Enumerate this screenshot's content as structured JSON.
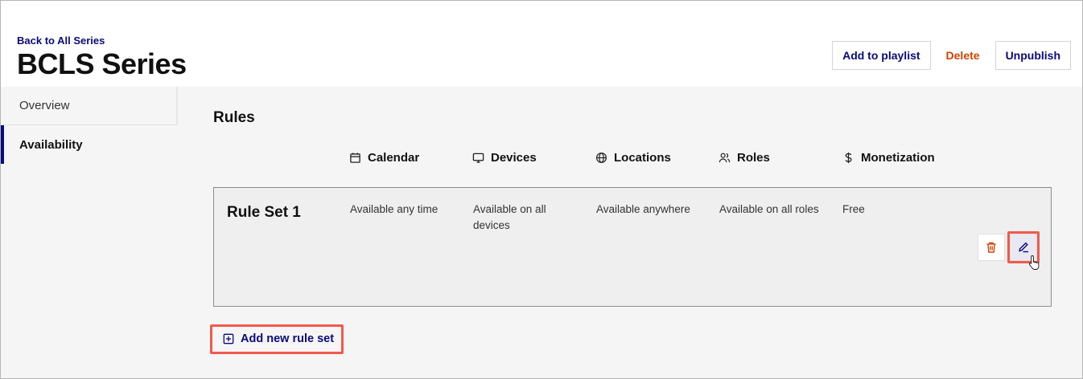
{
  "header": {
    "back_link": "Back to All Series",
    "title": "BCLS Series",
    "actions": {
      "add_to_playlist": "Add to playlist",
      "delete": "Delete",
      "unpublish": "Unpublish"
    }
  },
  "sidebar": {
    "items": [
      {
        "label": "Overview",
        "active": false
      },
      {
        "label": "Availability",
        "active": true
      }
    ]
  },
  "rules": {
    "title": "Rules",
    "columns": [
      {
        "label": "Calendar",
        "icon": "calendar-icon"
      },
      {
        "label": "Devices",
        "icon": "monitor-icon"
      },
      {
        "label": "Locations",
        "icon": "globe-icon"
      },
      {
        "label": "Roles",
        "icon": "users-icon"
      },
      {
        "label": "Monetization",
        "icon": "dollar-icon"
      }
    ],
    "rule_sets": [
      {
        "name": "Rule Set 1",
        "calendar": "Available any time",
        "devices": "Available on all devices",
        "locations": "Available anywhere",
        "roles": "Available on all roles",
        "monetization": "Free"
      }
    ],
    "add_rule_set": "Add new rule set"
  },
  "colors": {
    "accent": "#0a0a7a",
    "danger": "#d14300",
    "highlight": "#f05a4c"
  }
}
